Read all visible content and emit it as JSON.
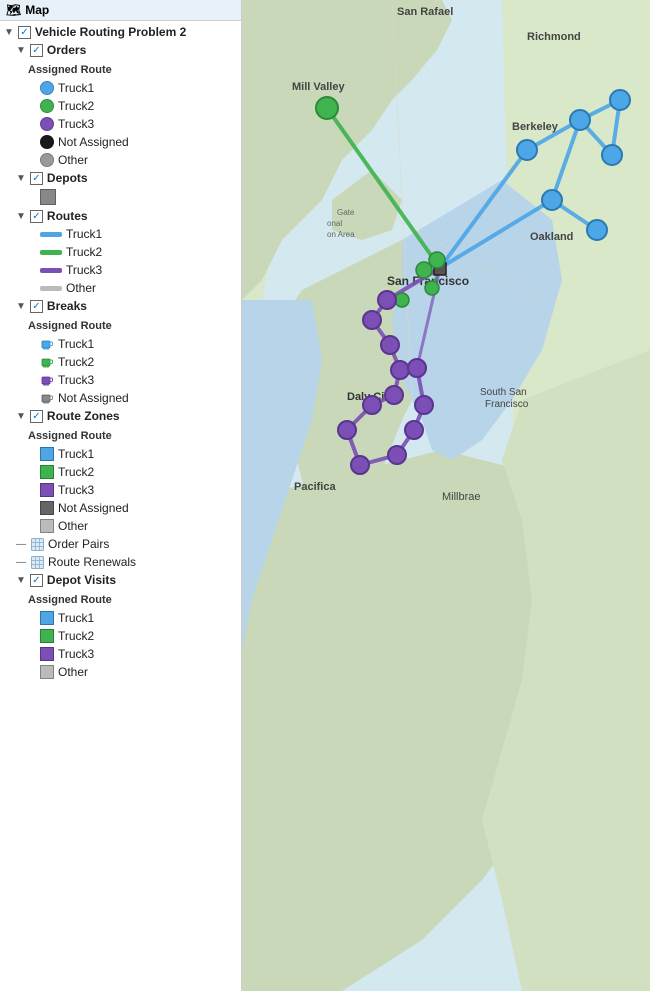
{
  "panel": {
    "header": "Map",
    "tree": {
      "root": {
        "label": "Vehicle Routing Problem 2",
        "checked": true,
        "children": [
          {
            "id": "orders",
            "label": "Orders",
            "checked": true,
            "sectionLabel": "Assigned Route",
            "items": [
              {
                "id": "orders-truck1",
                "label": "Truck1",
                "color": "#4da6e8",
                "type": "circle"
              },
              {
                "id": "orders-truck2",
                "label": "Truck2",
                "color": "#3eb34f",
                "type": "circle"
              },
              {
                "id": "orders-truck3",
                "label": "Truck3",
                "color": "#7b4fb5",
                "type": "circle"
              },
              {
                "id": "orders-notassigned",
                "label": "Not Assigned",
                "color": "#1a1a1a",
                "type": "circle"
              },
              {
                "id": "orders-other",
                "label": "Other",
                "color": "#999",
                "type": "circle"
              }
            ]
          },
          {
            "id": "depots",
            "label": "Depots",
            "checked": true,
            "items": [
              {
                "id": "depots-square",
                "label": "",
                "color": "#888",
                "type": "square"
              }
            ]
          },
          {
            "id": "routes",
            "label": "Routes",
            "checked": true,
            "items": [
              {
                "id": "routes-truck1",
                "label": "Truck1",
                "color": "#4da6e8",
                "type": "line"
              },
              {
                "id": "routes-truck2",
                "label": "Truck2",
                "color": "#3eb34f",
                "type": "line"
              },
              {
                "id": "routes-truck3",
                "label": "Truck3",
                "color": "#7b4fb5",
                "type": "line"
              },
              {
                "id": "routes-other",
                "label": "Other",
                "color": "#bbb",
                "type": "line"
              }
            ]
          },
          {
            "id": "breaks",
            "label": "Breaks",
            "checked": true,
            "sectionLabel": "Assigned Route",
            "items": [
              {
                "id": "breaks-truck1",
                "label": "Truck1",
                "color": "#4da6e8",
                "type": "cup"
              },
              {
                "id": "breaks-truck2",
                "label": "Truck2",
                "color": "#3eb34f",
                "type": "cup"
              },
              {
                "id": "breaks-truck3",
                "label": "Truck3",
                "color": "#7b4fb5",
                "type": "cup"
              },
              {
                "id": "breaks-notassigned",
                "label": "Not Assigned",
                "color": "#888",
                "type": "cup"
              }
            ]
          },
          {
            "id": "routezones",
            "label": "Route Zones",
            "checked": true,
            "sectionLabel": "Assigned Route",
            "items": [
              {
                "id": "rz-truck1",
                "label": "Truck1",
                "color": "#4da6e8",
                "type": "square"
              },
              {
                "id": "rz-truck2",
                "label": "Truck2",
                "color": "#3eb34f",
                "type": "square"
              },
              {
                "id": "rz-truck3",
                "label": "Truck3",
                "color": "#7b4fb5",
                "type": "square"
              },
              {
                "id": "rz-notassigned",
                "label": "Not Assigned",
                "color": "#666",
                "type": "square"
              },
              {
                "id": "rz-other",
                "label": "Other",
                "color": "#bbb",
                "type": "square"
              }
            ]
          },
          {
            "id": "orderpairs",
            "label": "Order Pairs",
            "checked": false,
            "hasGrid": true
          },
          {
            "id": "routerenewals",
            "label": "Route Renewals",
            "checked": false,
            "hasGrid": true
          },
          {
            "id": "depotvisits",
            "label": "Depot Visits",
            "checked": true,
            "sectionLabel": "Assigned Route",
            "items": [
              {
                "id": "dv-truck1",
                "label": "Truck1",
                "color": "#4da6e8",
                "type": "square"
              },
              {
                "id": "dv-truck2",
                "label": "Truck2",
                "color": "#3eb34f",
                "type": "square"
              },
              {
                "id": "dv-truck3",
                "label": "Truck3",
                "color": "#7b4fb5",
                "type": "square"
              },
              {
                "id": "dv-other",
                "label": "Other",
                "color": "#bbb",
                "type": "square"
              }
            ]
          }
        ]
      }
    }
  },
  "map": {
    "labels": [
      {
        "id": "san-rafael",
        "text": "San Rafael"
      },
      {
        "id": "richmond",
        "text": "Richmond"
      },
      {
        "id": "mill-valley",
        "text": "Mill Valley"
      },
      {
        "id": "berkeley",
        "text": "Berkeley"
      },
      {
        "id": "oakland",
        "text": "Oakland"
      },
      {
        "id": "san-francisco",
        "text": "San Francisco"
      },
      {
        "id": "daly-city",
        "text": "Daly City"
      },
      {
        "id": "south-sf",
        "text": "South San Francisco"
      },
      {
        "id": "pacifica",
        "text": "Pacifica"
      },
      {
        "id": "millbrae",
        "text": "Millbrae"
      }
    ]
  }
}
